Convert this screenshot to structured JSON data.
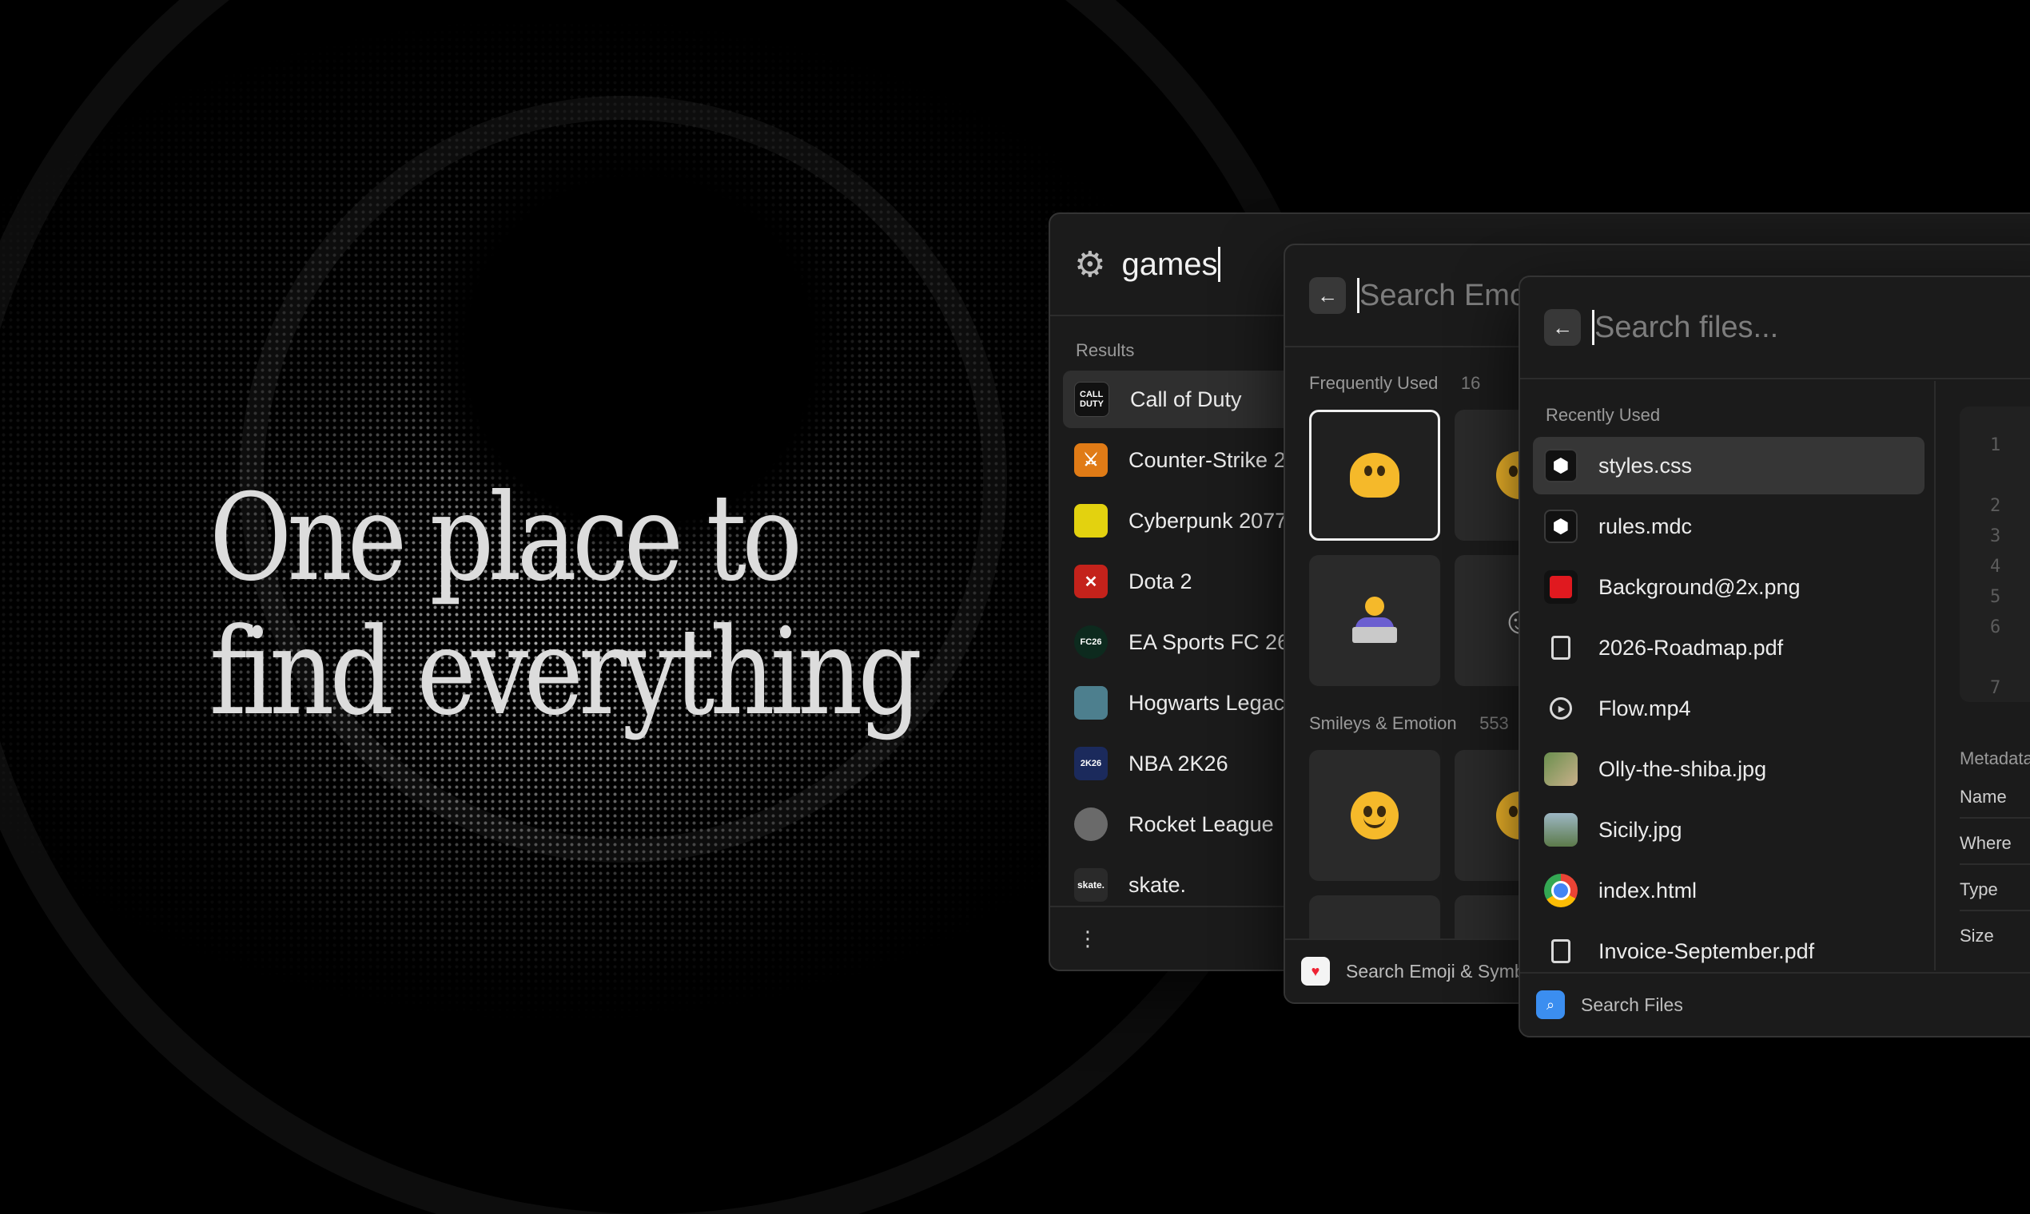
{
  "headline": {
    "line1": "One place to",
    "line2": "find everything"
  },
  "games_panel": {
    "query": "games",
    "results_label": "Results",
    "items": [
      {
        "label": "Call of Duty",
        "icon": "call-of-duty-icon",
        "icon_text": "CALL DUTY",
        "color": "#111111"
      },
      {
        "label": "Counter-Strike 2",
        "icon": "counter-strike-icon",
        "icon_text": "",
        "color": "#e07b16"
      },
      {
        "label": "Cyberpunk 2077",
        "icon": "cyberpunk-icon",
        "icon_text": "",
        "color": "#e3d20f"
      },
      {
        "label": "Dota 2",
        "icon": "dota-icon",
        "icon_text": "",
        "color": "#c4221b"
      },
      {
        "label": "EA Sports FC 26",
        "icon": "ea-fc-icon",
        "icon_text": "FC26",
        "color": "#0d2a1e"
      },
      {
        "label": "Hogwarts Legacy",
        "icon": "hogwarts-icon",
        "icon_text": "",
        "color": "#4d7f8e"
      },
      {
        "label": "NBA 2K26",
        "icon": "nba-icon",
        "icon_text": "2K26",
        "color": "#1b2a5c"
      },
      {
        "label": "Rocket League",
        "icon": "rocket-league-icon",
        "icon_text": "",
        "color": "#6a6a6a"
      },
      {
        "label": "skate.",
        "icon": "skate-icon",
        "icon_text": "skate.",
        "color": "#2a2a2a"
      }
    ]
  },
  "emoji_panel": {
    "placeholder": "Search Emoji",
    "frequently_used": "Frequently Used",
    "frequently_used_count": "16",
    "smileys": "Smileys & Emotion",
    "smileys_count": "553",
    "footer_label": "Search Emoji & Symbols"
  },
  "files_panel": {
    "placeholder": "Search files...",
    "recent_label": "Recently Used",
    "items": [
      {
        "label": "styles.css",
        "icon": "cube-icon"
      },
      {
        "label": "rules.mdc",
        "icon": "cube-icon"
      },
      {
        "label": "Background@2x.png",
        "icon": "red-image-icon"
      },
      {
        "label": "2026-Roadmap.pdf",
        "icon": "document-icon"
      },
      {
        "label": "Flow.mp4",
        "icon": "play-icon"
      },
      {
        "label": "Olly-the-shiba.jpg",
        "icon": "photo-thumbnail-icon"
      },
      {
        "label": "Sicily.jpg",
        "icon": "photo-thumbnail-icon"
      },
      {
        "label": "index.html",
        "icon": "chrome-icon"
      },
      {
        "label": "Invoice-September.pdf",
        "icon": "document-icon"
      }
    ],
    "line_numbers": [
      "1",
      "2",
      "3",
      "4",
      "5",
      "6",
      "7"
    ],
    "metadata_label": "Metadata",
    "meta_rows": [
      "Name",
      "Where",
      "Type",
      "Size"
    ],
    "footer_label": "Search Files"
  }
}
